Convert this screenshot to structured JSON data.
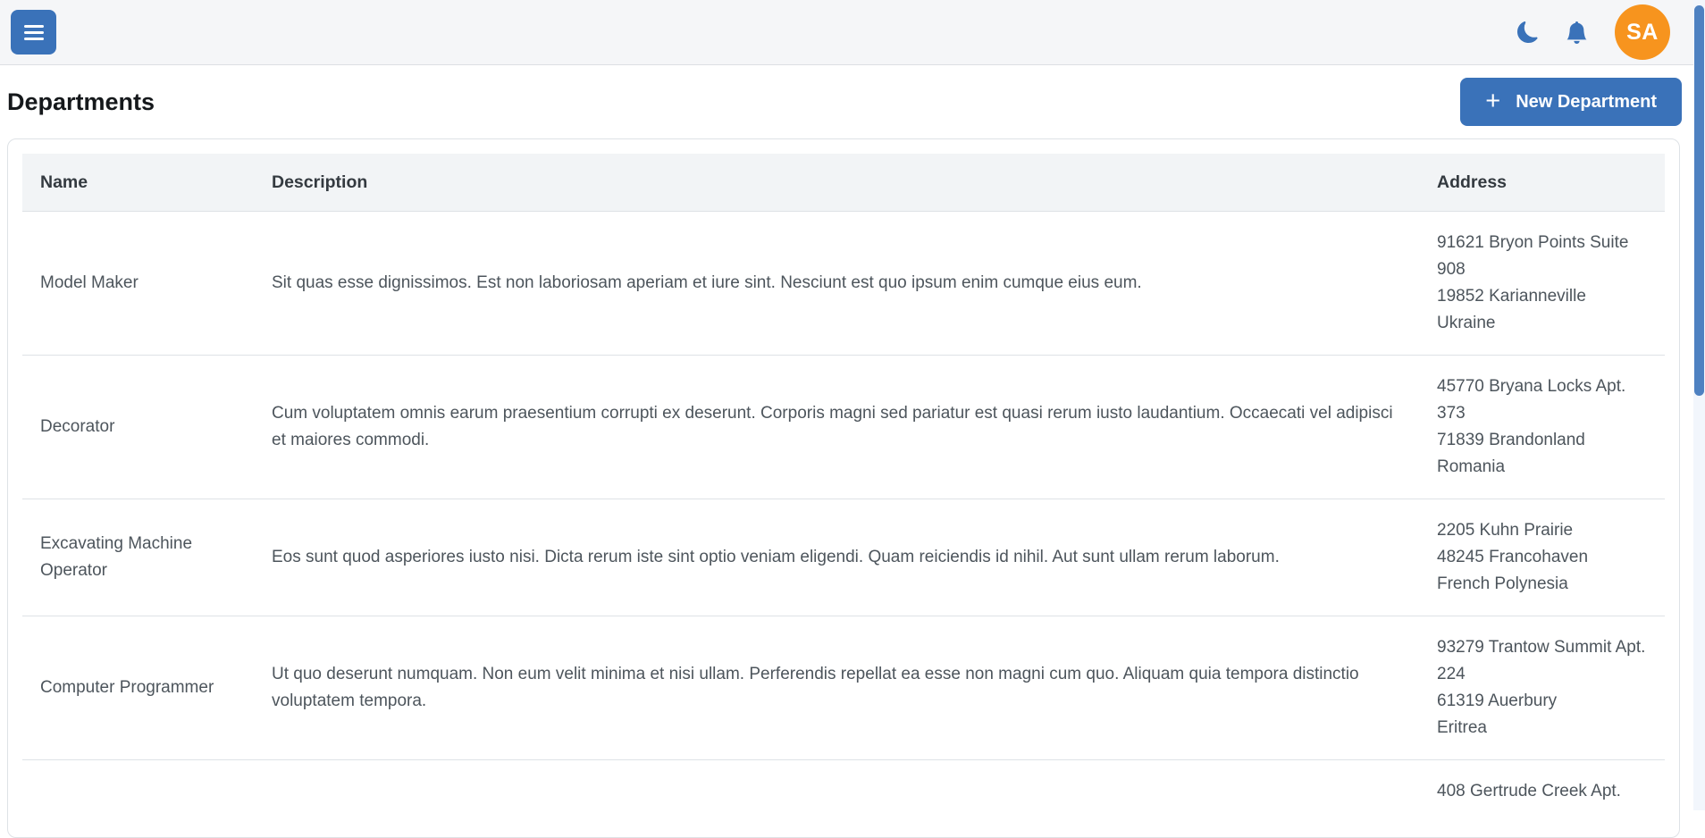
{
  "navbar": {
    "avatar_initials": "SA",
    "icons": [
      "hamburger-icon",
      "moon-icon",
      "bell-icon"
    ]
  },
  "page": {
    "title": "Departments",
    "new_department_button": "New Department",
    "plus": "+"
  },
  "table": {
    "headers": [
      "Name",
      "Description",
      "Address"
    ],
    "rows": [
      {
        "name": "Model Maker",
        "description": "Sit quas esse dignissimos. Est non laboriosam aperiam et iure sint. Nesciunt est quo ipsum enim cumque eius eum.",
        "address_lines": [
          "91621 Bryon Points Suite 908",
          "19852 Karianneville",
          "Ukraine"
        ]
      },
      {
        "name": "Decorator",
        "description": "Cum voluptatem omnis earum praesentium corrupti ex deserunt. Corporis magni sed pariatur est quasi rerum iusto laudantium. Occaecati vel adipisci et maiores commodi.",
        "address_lines": [
          "45770 Bryana Locks Apt. 373",
          "71839 Brandonland",
          "Romania"
        ]
      },
      {
        "name": "Excavating Machine Operator",
        "description": "Eos sunt quod asperiores iusto nisi. Dicta rerum iste sint optio veniam eligendi. Quam reiciendis id nihil. Aut sunt ullam rerum laborum.",
        "address_lines": [
          "2205 Kuhn Prairie",
          "48245 Francohaven",
          "French Polynesia"
        ]
      },
      {
        "name": "Computer Programmer",
        "description": "Ut quo deserunt numquam. Non eum velit minima et nisi ullam. Perferendis repellat ea esse non magni cum quo. Aliquam quia tempora distinctio voluptatem tempora.",
        "address_lines": [
          "93279 Trantow Summit Apt. 224",
          "61319 Auerbury",
          "Eritrea"
        ]
      },
      {
        "name": "",
        "description": "",
        "address_lines": [
          "408 Gertrude Creek Apt."
        ]
      }
    ]
  },
  "colors": {
    "primary": "#3a72b9",
    "avatar_bg": "#f7941e",
    "navbar_bg": "#f5f6f8",
    "table_header_bg": "#f2f4f6",
    "body_text": "#4d555c",
    "divider": "#dee2e6",
    "scrollbar_thumb": "#4e81c1"
  }
}
